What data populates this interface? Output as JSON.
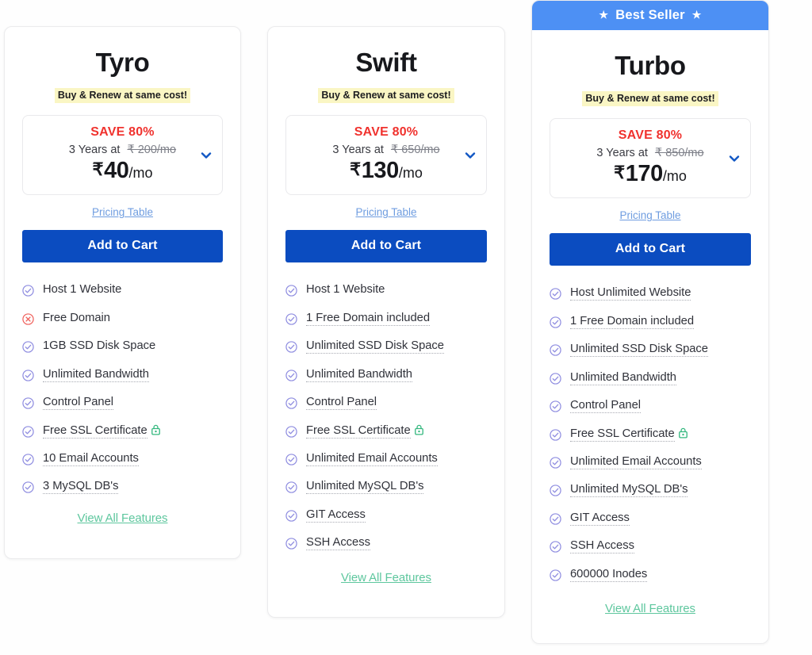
{
  "theme": {
    "banner_blue": "#4d90f4",
    "cta_blue": "#0b4cc0",
    "save_red": "#f0322e",
    "highlight_yellow": "#faf6c4",
    "link_blue": "#6f9de0",
    "viewall_green": "#5ec79e",
    "check_purple": "#8e8ce0",
    "cross_red": "#ef5f5a",
    "lock_green": "#35b87f"
  },
  "plans": [
    {
      "name": "Tyro",
      "badge": null,
      "badge_star": "★",
      "renew_note": "Buy & Renew at same cost!",
      "save_label": "SAVE 80%",
      "term": "3 Years at",
      "old_price": "₹ 200/mo",
      "currency": "₹",
      "price": "40",
      "period": "/mo",
      "chevron_icon": "chevron-down-icon",
      "pricing_table_label": "Pricing Table",
      "cta_label": "Add to Cart",
      "view_all_label": "View All Features",
      "features": [
        {
          "icon": "check",
          "text": "Host 1 Website",
          "tooltip": false,
          "lock": false
        },
        {
          "icon": "cross",
          "text": "Free Domain",
          "tooltip": false,
          "lock": false
        },
        {
          "icon": "check",
          "text": "1GB SSD Disk Space",
          "tooltip": false,
          "lock": false
        },
        {
          "icon": "check",
          "text": "Unlimited Bandwidth",
          "tooltip": true,
          "lock": false
        },
        {
          "icon": "check",
          "text": "Control Panel",
          "tooltip": true,
          "lock": false
        },
        {
          "icon": "check",
          "text": "Free SSL Certificate",
          "tooltip": true,
          "lock": true
        },
        {
          "icon": "check",
          "text": "10 Email Accounts",
          "tooltip": true,
          "lock": false
        },
        {
          "icon": "check",
          "text": "3 MySQL DB's",
          "tooltip": true,
          "lock": false
        }
      ]
    },
    {
      "name": "Swift",
      "badge": null,
      "badge_star": "★",
      "renew_note": "Buy & Renew at same cost!",
      "save_label": "SAVE 80%",
      "term": "3 Years at",
      "old_price": "₹ 650/mo",
      "currency": "₹",
      "price": "130",
      "period": "/mo",
      "chevron_icon": "chevron-down-icon",
      "pricing_table_label": "Pricing Table",
      "cta_label": "Add to Cart",
      "view_all_label": "View All Features",
      "features": [
        {
          "icon": "check",
          "text": "Host 1 Website",
          "tooltip": false,
          "lock": false
        },
        {
          "icon": "check",
          "text": "1 Free Domain included",
          "tooltip": true,
          "lock": false
        },
        {
          "icon": "check",
          "text": "Unlimited SSD Disk Space",
          "tooltip": true,
          "lock": false
        },
        {
          "icon": "check",
          "text": "Unlimited Bandwidth",
          "tooltip": true,
          "lock": false
        },
        {
          "icon": "check",
          "text": "Control Panel",
          "tooltip": true,
          "lock": false
        },
        {
          "icon": "check",
          "text": "Free SSL Certificate",
          "tooltip": true,
          "lock": true
        },
        {
          "icon": "check",
          "text": "Unlimited Email Accounts",
          "tooltip": true,
          "lock": false
        },
        {
          "icon": "check",
          "text": "Unlimited MySQL DB's",
          "tooltip": true,
          "lock": false
        },
        {
          "icon": "check",
          "text": "GIT Access",
          "tooltip": true,
          "lock": false
        },
        {
          "icon": "check",
          "text": "SSH Access",
          "tooltip": true,
          "lock": false
        }
      ]
    },
    {
      "name": "Turbo",
      "badge": "Best Seller",
      "badge_star": "★",
      "renew_note": "Buy & Renew at same cost!",
      "save_label": "SAVE 80%",
      "term": "3 Years at",
      "old_price": "₹ 850/mo",
      "currency": "₹",
      "price": "170",
      "period": "/mo",
      "chevron_icon": "chevron-down-icon",
      "pricing_table_label": "Pricing Table",
      "cta_label": "Add to Cart",
      "view_all_label": "View All Features",
      "features": [
        {
          "icon": "check",
          "text": "Host Unlimited Website",
          "tooltip": true,
          "lock": false
        },
        {
          "icon": "check",
          "text": "1 Free Domain included",
          "tooltip": true,
          "lock": false
        },
        {
          "icon": "check",
          "text": "Unlimited SSD Disk Space",
          "tooltip": true,
          "lock": false
        },
        {
          "icon": "check",
          "text": "Unlimited Bandwidth",
          "tooltip": true,
          "lock": false
        },
        {
          "icon": "check",
          "text": "Control Panel",
          "tooltip": true,
          "lock": false
        },
        {
          "icon": "check",
          "text": "Free SSL Certificate",
          "tooltip": true,
          "lock": true
        },
        {
          "icon": "check",
          "text": "Unlimited Email Accounts",
          "tooltip": true,
          "lock": false
        },
        {
          "icon": "check",
          "text": "Unlimited MySQL DB's",
          "tooltip": true,
          "lock": false
        },
        {
          "icon": "check",
          "text": "GIT Access",
          "tooltip": true,
          "lock": false
        },
        {
          "icon": "check",
          "text": "SSH Access",
          "tooltip": true,
          "lock": false
        },
        {
          "icon": "check",
          "text": "600000 Inodes",
          "tooltip": true,
          "lock": false
        }
      ]
    }
  ]
}
